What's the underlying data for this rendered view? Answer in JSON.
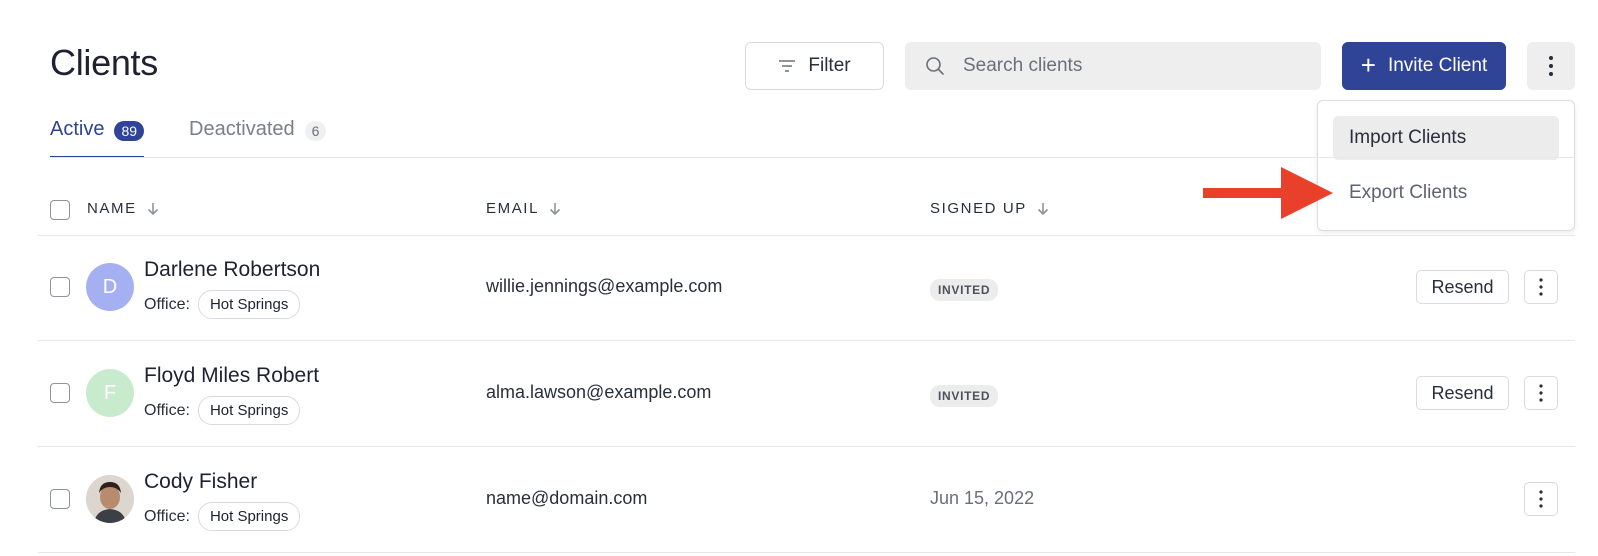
{
  "page": {
    "title": "Clients"
  },
  "toolbar": {
    "filter_label": "Filter",
    "search_placeholder": "Search clients",
    "invite_label": "Invite Client"
  },
  "menu": {
    "items": [
      {
        "label": "Import Clients"
      },
      {
        "label": "Export Clients"
      }
    ]
  },
  "tabs": [
    {
      "label": "Active",
      "count": "89"
    },
    {
      "label": "Deactivated",
      "count": "6"
    }
  ],
  "table": {
    "columns": [
      "NAME",
      "EMAIL",
      "SIGNED UP"
    ],
    "office_label": "Office:",
    "rows": [
      {
        "initial": "D",
        "name": "Darlene Robertson",
        "office": "Hot Springs",
        "email": "willie.jennings@example.com",
        "status": "INVITED",
        "action": "Resend"
      },
      {
        "initial": "F",
        "name": "Floyd Miles Robert",
        "office": "Hot Springs",
        "email": "alma.lawson@example.com",
        "status": "INVITED",
        "action": "Resend"
      },
      {
        "initial": "",
        "name": "Cody Fisher",
        "office": "Hot Springs",
        "email": "name@domain.com",
        "signed_up": "Jun 15, 2022"
      }
    ]
  },
  "colors": {
    "primary": "#2f4497",
    "annotation_arrow": "#e8402a"
  }
}
